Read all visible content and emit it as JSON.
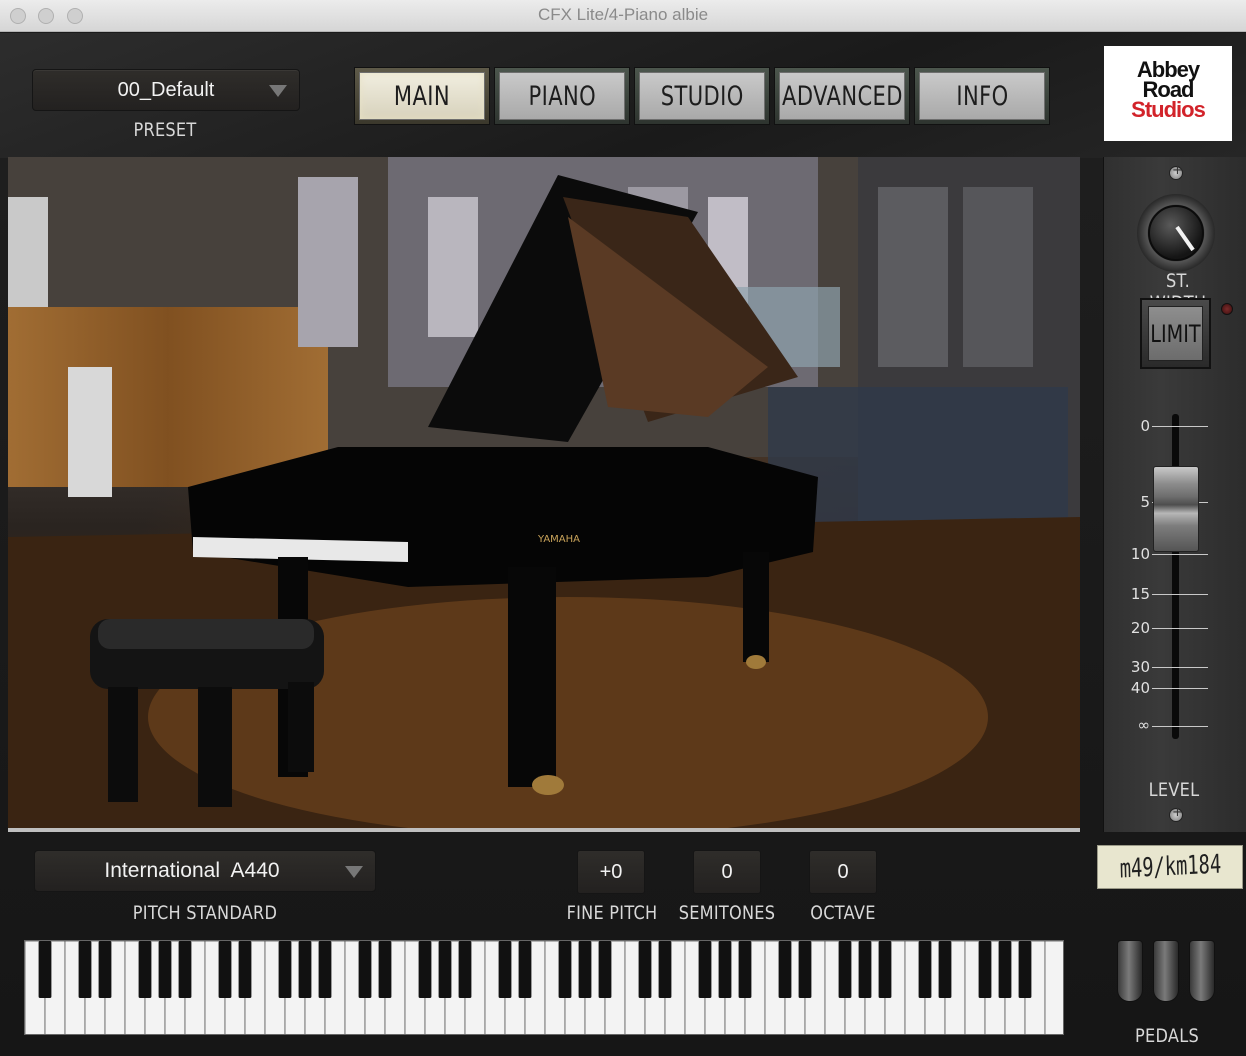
{
  "window": {
    "title": "CFX Lite/4-Piano albie"
  },
  "preset": {
    "value": "00_Default",
    "label": "PRESET"
  },
  "tabs": [
    {
      "label": "MAIN",
      "active": true
    },
    {
      "label": "PIANO",
      "active": false
    },
    {
      "label": "STUDIO",
      "active": false
    },
    {
      "label": "ADVANCED",
      "active": false
    },
    {
      "label": "INFO",
      "active": false
    }
  ],
  "logo": {
    "line1": "Abbey",
    "line2": "Road",
    "line3": "Studios",
    "accent": "#d2232a"
  },
  "stereo_width": {
    "label": "ST. WIDTH"
  },
  "limit": {
    "label": "LIMIT"
  },
  "level": {
    "label": "LEVEL",
    "ticks": [
      "0",
      "5",
      "10",
      "15",
      "20",
      "30",
      "40",
      "∞"
    ]
  },
  "mic": {
    "label": "m49/km184"
  },
  "pitch": {
    "value": "International  A440",
    "label": "PITCH STANDARD"
  },
  "fine_pitch": {
    "value": "+0",
    "label": "FINE PITCH"
  },
  "semitones": {
    "value": "0",
    "label": "SEMITONES"
  },
  "octave": {
    "value": "0",
    "label": "OCTAVE"
  },
  "pedals": {
    "label": "PEDALS"
  }
}
